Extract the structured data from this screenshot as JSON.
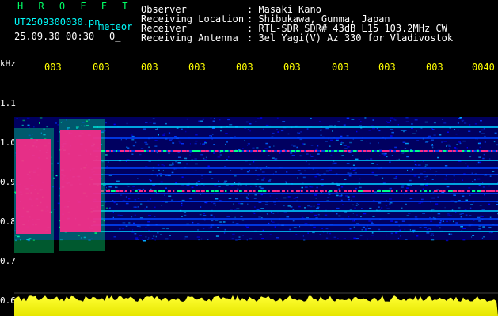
{
  "header": {
    "brand": "H R O F F T",
    "filename": "UT2509300030.pn",
    "meteor_label": "meteor",
    "datetime": "25.09.30 00:30",
    "count": "0_",
    "fields": [
      {
        "label": "Observer",
        "value": ": Masaki Kano"
      },
      {
        "label": "Receiving Location",
        "value": ": Shibukawa, Gunma, Japan"
      },
      {
        "label": "Receiver",
        "value": ": RTL-SDR SDR# 43dB L15 103.2MHz CW"
      },
      {
        "label": "Receiving Antenna",
        "value": ": 3el Yagi(V) Az 330 for Vladivostok"
      }
    ]
  },
  "axis": {
    "unit": "kHz",
    "y_ticks": [
      "1.1",
      "1.0",
      "0.9",
      "0.8",
      "0.7",
      "0.6"
    ],
    "x_ticks": [
      "003",
      "003",
      "003",
      "003",
      "003",
      "003",
      "003",
      "003",
      "003",
      "0040"
    ]
  },
  "colors": {
    "background": "#000000",
    "brand": "#00ff66",
    "time_ticks": "#ffff00",
    "signal_low": "#0000cc",
    "signal_mid": "#00ff88",
    "signal_high": "#ff2a8a",
    "level_bar": "#ffff00"
  }
}
